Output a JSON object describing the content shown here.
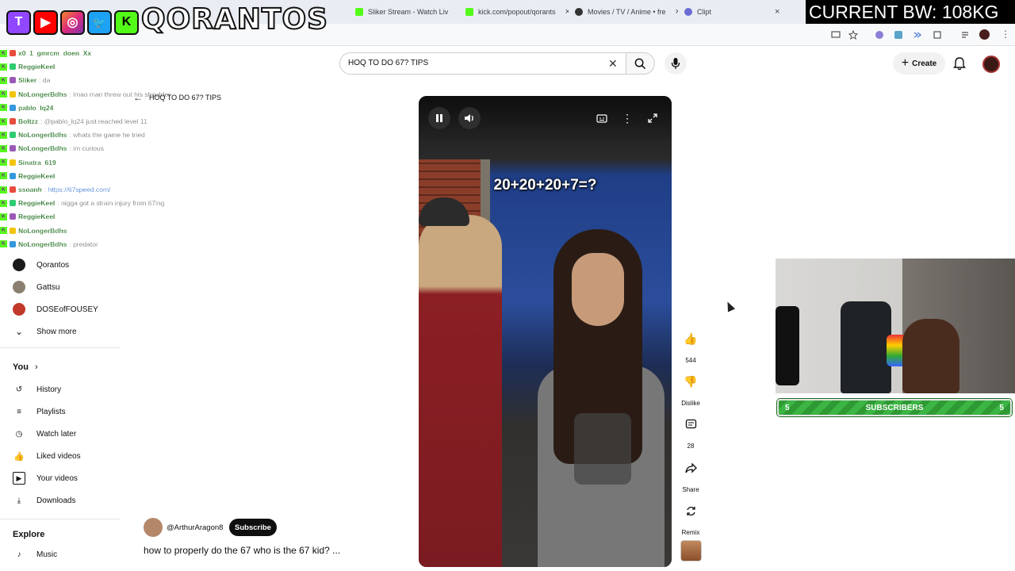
{
  "browser": {
    "tabs": [
      {
        "title": "Sliker Stream - Watch Liv",
        "color": "#53fc18"
      },
      {
        "title": "kick.com/popout/qorants",
        "color": "#53fc18"
      },
      {
        "title": "Movies / TV / Anime • fre",
        "color": "#333333"
      },
      {
        "title": "Clipt",
        "color": "#6b6bd6"
      }
    ],
    "tab_close": "×"
  },
  "overlay": {
    "brand": "QORANTOS",
    "bw_text": "CURRENT BW: 108KG",
    "social_icons": [
      "twitch-icon",
      "youtube-icon",
      "instagram-icon",
      "twitter-icon",
      "kick-icon"
    ],
    "social_glyphs": [
      "T",
      "▶",
      "◎",
      "🐦",
      "K"
    ]
  },
  "header": {
    "search_value": "HOQ TO DO 67? TIPS",
    "create_label": "Create"
  },
  "chat": [
    {
      "user": "x0_1_gmrcm_doen_Xx",
      "msg": ""
    },
    {
      "user": "ReggieKeel",
      "msg": ""
    },
    {
      "user": "Sliker",
      "msg": ": da"
    },
    {
      "user": "NoLongerBdhs",
      "msg": ": lmao man threw out his shoulder"
    },
    {
      "user": "pablo_lq24",
      "msg": ""
    },
    {
      "user": "Boltzz",
      "msg": ": @pablo_lq24 just reached level 11"
    },
    {
      "user": "NoLongerBdhs",
      "msg": ": whats the game he tried"
    },
    {
      "user": "NoLongerBdhs",
      "msg": ": im curious"
    },
    {
      "user": "Sinatra_619",
      "msg": ""
    },
    {
      "user": "ReggieKeel",
      "msg": ""
    },
    {
      "user": "ssoanh",
      "msg": ": https://67speed.com/"
    },
    {
      "user": "ReggieKeel",
      "msg": ": nigga got a strain injury from 67ing"
    },
    {
      "user": "ReggieKeel",
      "msg": ""
    },
    {
      "user": "NoLongerBdhs",
      "msg": ""
    },
    {
      "user": "NoLongerBdhs",
      "msg": ": predator"
    }
  ],
  "sidebar": {
    "subscriptions": [
      {
        "name": "Qorantos",
        "color": "#1a1a1a"
      },
      {
        "name": "Gattsu",
        "color": "#8a7f70"
      },
      {
        "name": "DOSEofFOUSEY",
        "color": "#c0392b"
      }
    ],
    "show_more": "Show more",
    "you_heading": "You",
    "you_items": [
      {
        "label": "History",
        "icon": "history-icon",
        "glyph": "↺"
      },
      {
        "label": "Playlists",
        "icon": "playlists-icon",
        "glyph": "≡"
      },
      {
        "label": "Watch later",
        "icon": "watch-later-icon",
        "glyph": "◷"
      },
      {
        "label": "Liked videos",
        "icon": "like-icon",
        "glyph": "👍"
      },
      {
        "label": "Your videos",
        "icon": "your-videos-icon",
        "glyph": "▶"
      },
      {
        "label": "Downloads",
        "icon": "download-icon",
        "glyph": "⤓"
      }
    ],
    "explore_heading": "Explore",
    "explore_items": [
      {
        "label": "Music",
        "icon": "music-icon",
        "glyph": "♪"
      }
    ]
  },
  "short": {
    "back_title": "HOQ TO DO 67? TIPS",
    "overlay_text": "20+20+20+7=?",
    "channel_handle": "@ArthurAragon8",
    "subscribe_label": "Subscribe",
    "title": "how to properly do the 67 who is the 67 kid? ..."
  },
  "actions": {
    "like_count": "544",
    "dislike_label": "Dislike",
    "comment_count": "28",
    "share_label": "Share",
    "remix_label": "Remix"
  },
  "subscriber_goal": {
    "label": "SUBSCRIBERS",
    "current": "5",
    "target": "5"
  }
}
